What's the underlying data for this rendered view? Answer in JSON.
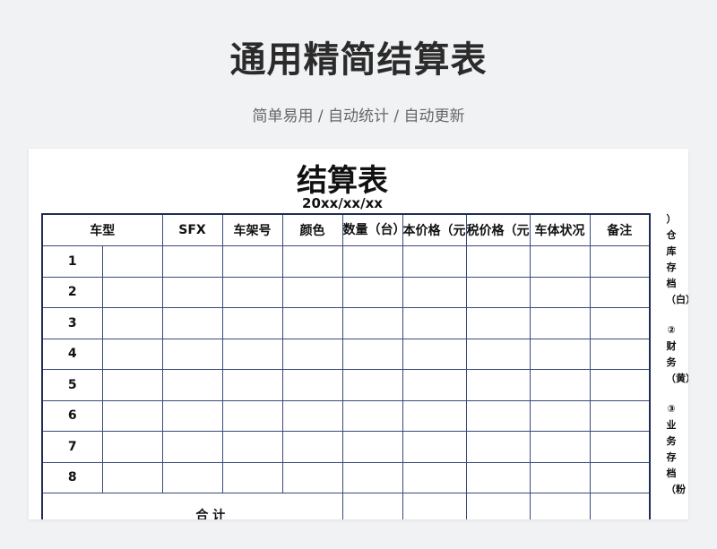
{
  "page": {
    "title": "通用精简结算表",
    "subtitle": "简单易用 / 自动统计 / 自动更新"
  },
  "sheet": {
    "title": "结算表",
    "date": "20xx/xx/xx",
    "headers": [
      "车型",
      "SFX",
      "车架号",
      "颜色",
      "数量（台）",
      "本价格（元",
      "税价格（元",
      "车体状况",
      "备注"
    ],
    "rows": [
      "1",
      "2",
      "3",
      "4",
      "5",
      "6",
      "7",
      "8"
    ],
    "total_label": "合 计",
    "side_notes": [
      "）仓库存档（白）",
      "②财务（黄）",
      "③业务存档（粉"
    ]
  }
}
